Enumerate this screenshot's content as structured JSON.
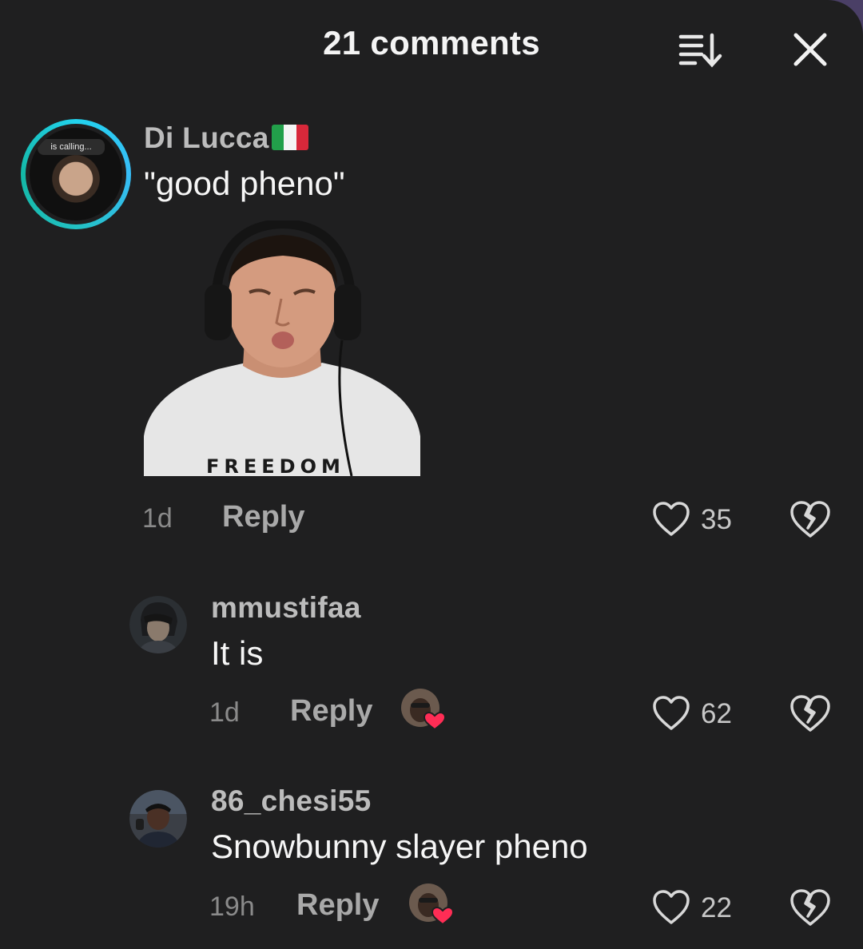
{
  "header": {
    "title": "21 comments",
    "sort_icon": "sort-descending-icon",
    "close_icon": "close-icon"
  },
  "comments": [
    {
      "username": "Di Lucca",
      "flag": "italy-flag",
      "avatar_banner": "is calling...",
      "text": "\"good pheno\"",
      "sticker_shirt_text": "FREEDOM",
      "time": "1d",
      "reply_label": "Reply",
      "likes": "35"
    },
    {
      "username": "mmustifaa",
      "text": "It is",
      "time": "1d",
      "reply_label": "Reply",
      "likes": "62",
      "creator_liked": true
    },
    {
      "username": "86_chesi55",
      "text": "Snowbunny slayer pheno",
      "time": "19h",
      "reply_label": "Reply",
      "likes": "22",
      "creator_liked": true
    }
  ],
  "colors": {
    "background": "#1f1f20",
    "ring": "#22d3ee",
    "heart_badge": "#ff2d55"
  }
}
